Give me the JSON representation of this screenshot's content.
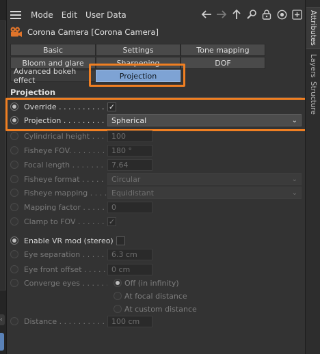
{
  "menubar": {
    "items": [
      "Mode",
      "Edit",
      "User Data"
    ],
    "icons": [
      "arrow-left-icon",
      "arrow-right-icon",
      "arrow-up-icon",
      "search-icon",
      "lock-icon",
      "target-icon",
      "add-panel-icon"
    ]
  },
  "object": {
    "title": "Corona Camera [Corona Camera]"
  },
  "tabs": {
    "row1": [
      "Basic",
      "Settings",
      "Tone mapping"
    ],
    "row2": [
      "Bloom and glare",
      "Sharpening",
      "DOF"
    ],
    "row3": [
      "Advanced bokeh effect",
      "Projection"
    ],
    "selected": "Projection"
  },
  "side_tabs": [
    "Attributes",
    "Layers",
    "Structure"
  ],
  "section": {
    "title": "Projection"
  },
  "params": {
    "override": {
      "label": "Override . . . . . . . . . .",
      "checked": true
    },
    "projection": {
      "label": "Projection . . . . . . . . .",
      "value": "Spherical"
    },
    "cylindrical_height": {
      "label": "Cylindrical height . . .",
      "value": "100"
    },
    "fisheye_fov": {
      "label": "Fisheye FOV. . . . . . . .",
      "value": "180 °"
    },
    "focal_length": {
      "label": "Focal length . . . . . . .",
      "value": "7.64"
    },
    "fisheye_format": {
      "label": "Fisheye format . . . . .",
      "value": "Circular"
    },
    "fisheye_mapping": {
      "label": "Fisheye mapping . . . .",
      "value": "Equidistant"
    },
    "mapping_factor": {
      "label": "Mapping factor . . . . .",
      "value": "0"
    },
    "clamp_fov": {
      "label": "Clamp to FOV . . . . . .",
      "checked": true
    },
    "vr_mode": {
      "label": "Enable VR mod (stereo)",
      "checked": false
    },
    "eye_separation": {
      "label": "Eye separation . . . . . .",
      "value": "6.3 cm"
    },
    "eye_front_offset": {
      "label": "Eye front offset . . . . .",
      "value": "0 cm"
    },
    "converge_eyes": {
      "label": "Converge eyes . . . . . .",
      "options": [
        "Off (in infinity)",
        "At focal distance",
        "At custom distance"
      ],
      "selected": "Off (in infinity)"
    },
    "distance": {
      "label": "Distance . . . . . . . . . . .",
      "value": "100 cm"
    }
  },
  "colors": {
    "highlight": "#f07f22",
    "selected_tab": "#7ea3d4"
  }
}
